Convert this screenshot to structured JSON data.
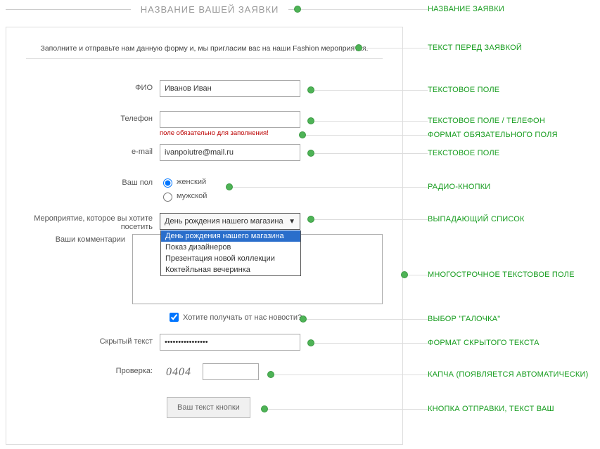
{
  "header": {
    "title": "НАЗВАНИЕ ВАШЕЙ ЗАЯВКИ"
  },
  "intro": "Заполните и отправьте нам данную форму и, мы пригласим вас на наши Fashion мероприятия.",
  "fields": {
    "fio": {
      "label": "ФИО",
      "value": "Иванов Иван"
    },
    "phone": {
      "label": "Телефон",
      "value": "",
      "error": "поле обязательно для заполнения!"
    },
    "email": {
      "label": "e-mail",
      "value": "ivanpoiutre@mail.ru"
    },
    "gender": {
      "label": "Ваш пол",
      "options": [
        "женский",
        "мужской"
      ],
      "selected": "женский"
    },
    "event": {
      "label": "Мероприятие, которое вы хотите посетить",
      "selected": "День рождения нашего магазина",
      "options": [
        "День рождения нашего магазина",
        "Показ дизайнеров",
        "Презентация новой коллекции",
        "Коктейльная вечеринка"
      ]
    },
    "comments": {
      "label": "Ваши комментарии",
      "value": ""
    },
    "news": {
      "label": "Хотите получать от нас новости?",
      "checked": true
    },
    "hidden": {
      "label": "Скрытый текст",
      "value": "••••••••••••••••"
    },
    "captcha": {
      "label": "Проверка:",
      "image_text": "0404",
      "value": ""
    },
    "submit": {
      "label": "Ваш текст кнопки"
    }
  },
  "annotations": {
    "header": "НАЗВАНИЕ ЗАЯВКИ",
    "intro": "ТЕКСТ ПЕРЕД ЗАЯВКОЙ",
    "fio": "ТЕКСТОВОЕ ПОЛЕ",
    "phone": "ТЕКСТОВОЕ ПОЛЕ / ТЕЛЕФОН",
    "phone_err": "ФОРМАТ ОБЯЗАТЕЛЬНОГО ПОЛЯ",
    "email": "ТЕКСТОВОЕ ПОЛЕ",
    "gender": "РАДИО-КНОПКИ",
    "event": "ВЫПАДАЮЩИЙ СПИСОК",
    "comments": "МНОГОСТРОЧНОЕ ТЕКСТОВОЕ ПОЛЕ",
    "news": "ВЫБОР \"ГАЛОЧКА\"",
    "hidden": "ФОРМАТ СКРЫТОГО ТЕКСТА",
    "captcha": "КАПЧА (ПОЯВЛЯЕТСЯ АВТОМАТИЧЕСКИ)",
    "submit": "КНОПКА ОТПРАВКИ, ТЕКСТ ВАШ"
  }
}
